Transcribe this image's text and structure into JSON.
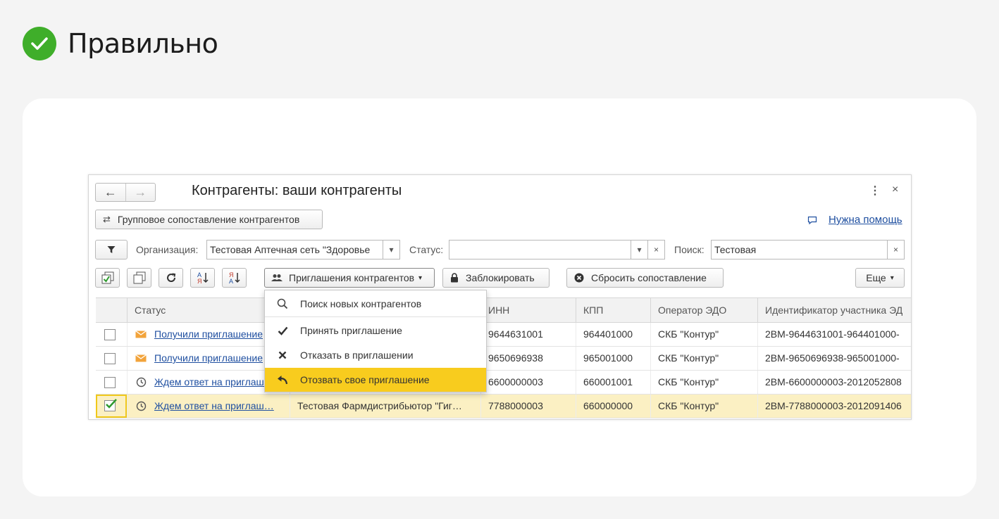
{
  "verdict": {
    "label": "Правильно",
    "color": "#3fae2a"
  },
  "window": {
    "title": "Контрагенты: ваши контрагенты",
    "nav_back": "←",
    "nav_forward": "→",
    "more_icon": "⋮",
    "close_icon": "×"
  },
  "toolbar1": {
    "group_match_label": "Групповое сопоставление контрагентов",
    "help_label": "Нужна помощь"
  },
  "filters": {
    "org_label": "Организация:",
    "org_value": "Тестовая Аптечная сеть \"Здоровье",
    "status_label": "Статус:",
    "status_value": "",
    "search_label": "Поиск:",
    "search_value": "Тестовая"
  },
  "toolbar2": {
    "invitations_label": "Приглашения контрагентов",
    "block_label": "Заблокировать",
    "reset_label": "Сбросить сопоставление",
    "more_label": "Еще",
    "sort_asc_letters": [
      "А",
      "Я"
    ],
    "sort_desc_letters": [
      "Я",
      "А"
    ]
  },
  "dropdown_menu": {
    "items": [
      {
        "label": "Поиск новых контрагентов",
        "icon": "search-icon"
      },
      {
        "label": "Принять приглашение",
        "icon": "check-icon"
      },
      {
        "label": "Отказать в приглашении",
        "icon": "cross-icon"
      },
      {
        "label": "Отозвать свое приглашение",
        "icon": "undo-icon",
        "highlighted": true
      }
    ]
  },
  "table": {
    "columns": [
      "Статус",
      "",
      "ИНН",
      "КПП",
      "Оператор ЭДО",
      "Идентификатор участника ЭД"
    ],
    "rows": [
      {
        "checked": false,
        "status_icon": "envelope-icon",
        "status": "Получили приглашение",
        "name": "",
        "inn": "9644631001",
        "kpp": "964401000",
        "operator": "СКБ \"Контур\"",
        "edo_id": "2ВМ-9644631001-964401000-"
      },
      {
        "checked": false,
        "status_icon": "envelope-icon",
        "status": "Получили приглашение",
        "name": "",
        "inn": "9650696938",
        "kpp": "965001000",
        "operator": "СКБ \"Контур\"",
        "edo_id": "2ВМ-9650696938-965001000-"
      },
      {
        "checked": false,
        "status_icon": "clock-icon",
        "status": "Ждем ответ на приглашение",
        "name": "",
        "inn": "6600000003",
        "kpp": "660001001",
        "operator": "СКБ \"Контур\"",
        "edo_id": "2ВМ-6600000003-2012052808"
      },
      {
        "checked": true,
        "status_icon": "clock-icon",
        "status": "Ждем ответ на приглаш…",
        "name": "Тестовая Фармдистрибьютор \"Гиг…",
        "inn": "7788000003",
        "kpp": "660000000",
        "operator": "СКБ \"Контур\"",
        "edo_id": "2ВМ-7788000003-2012091406"
      }
    ]
  }
}
